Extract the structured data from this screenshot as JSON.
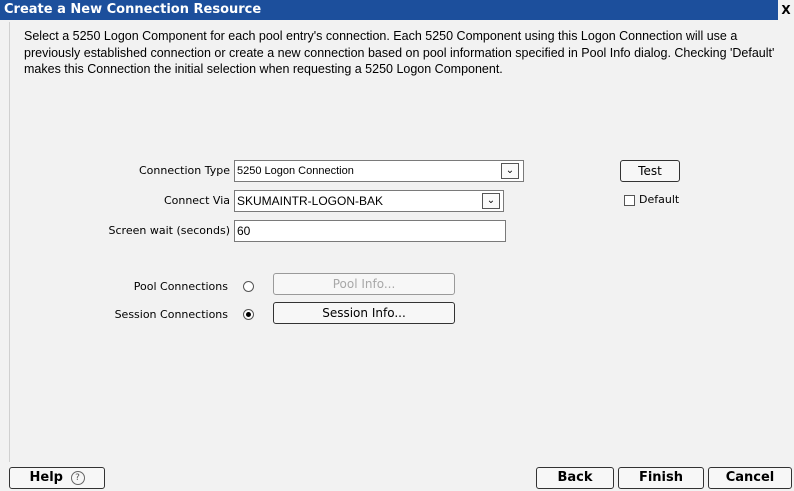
{
  "window": {
    "title": "Create a New Connection Resource",
    "close_label": "X"
  },
  "description": "Select a 5250 Logon Component for each pool entry's connection. Each 5250 Component using this Logon Connection will use a previously established connection or create a new connection based on pool information specified in Pool Info dialog. Checking 'Default' makes this Connection the initial selection when requesting a 5250 Logon Component.",
  "form": {
    "connection_type_label": "Connection Type",
    "connection_type_value": "5250 Logon Connection",
    "connect_via_label": "Connect Via",
    "connect_via_value": "SKUMAINTR-LOGON-BAK",
    "screen_wait_label": "Screen wait (seconds)",
    "screen_wait_value": "60",
    "test_label": "Test",
    "default_label": "Default",
    "default_checked": false,
    "pool_connections_label": "Pool Connections",
    "pool_connections_selected": false,
    "pool_info_label": "Pool Info...",
    "session_connections_label": "Session Connections",
    "session_connections_selected": true,
    "session_info_label": "Session Info..."
  },
  "footer": {
    "help_label": "Help",
    "help_icon": "?",
    "back_label": "Back",
    "finish_label": "Finish",
    "cancel_label": "Cancel"
  }
}
